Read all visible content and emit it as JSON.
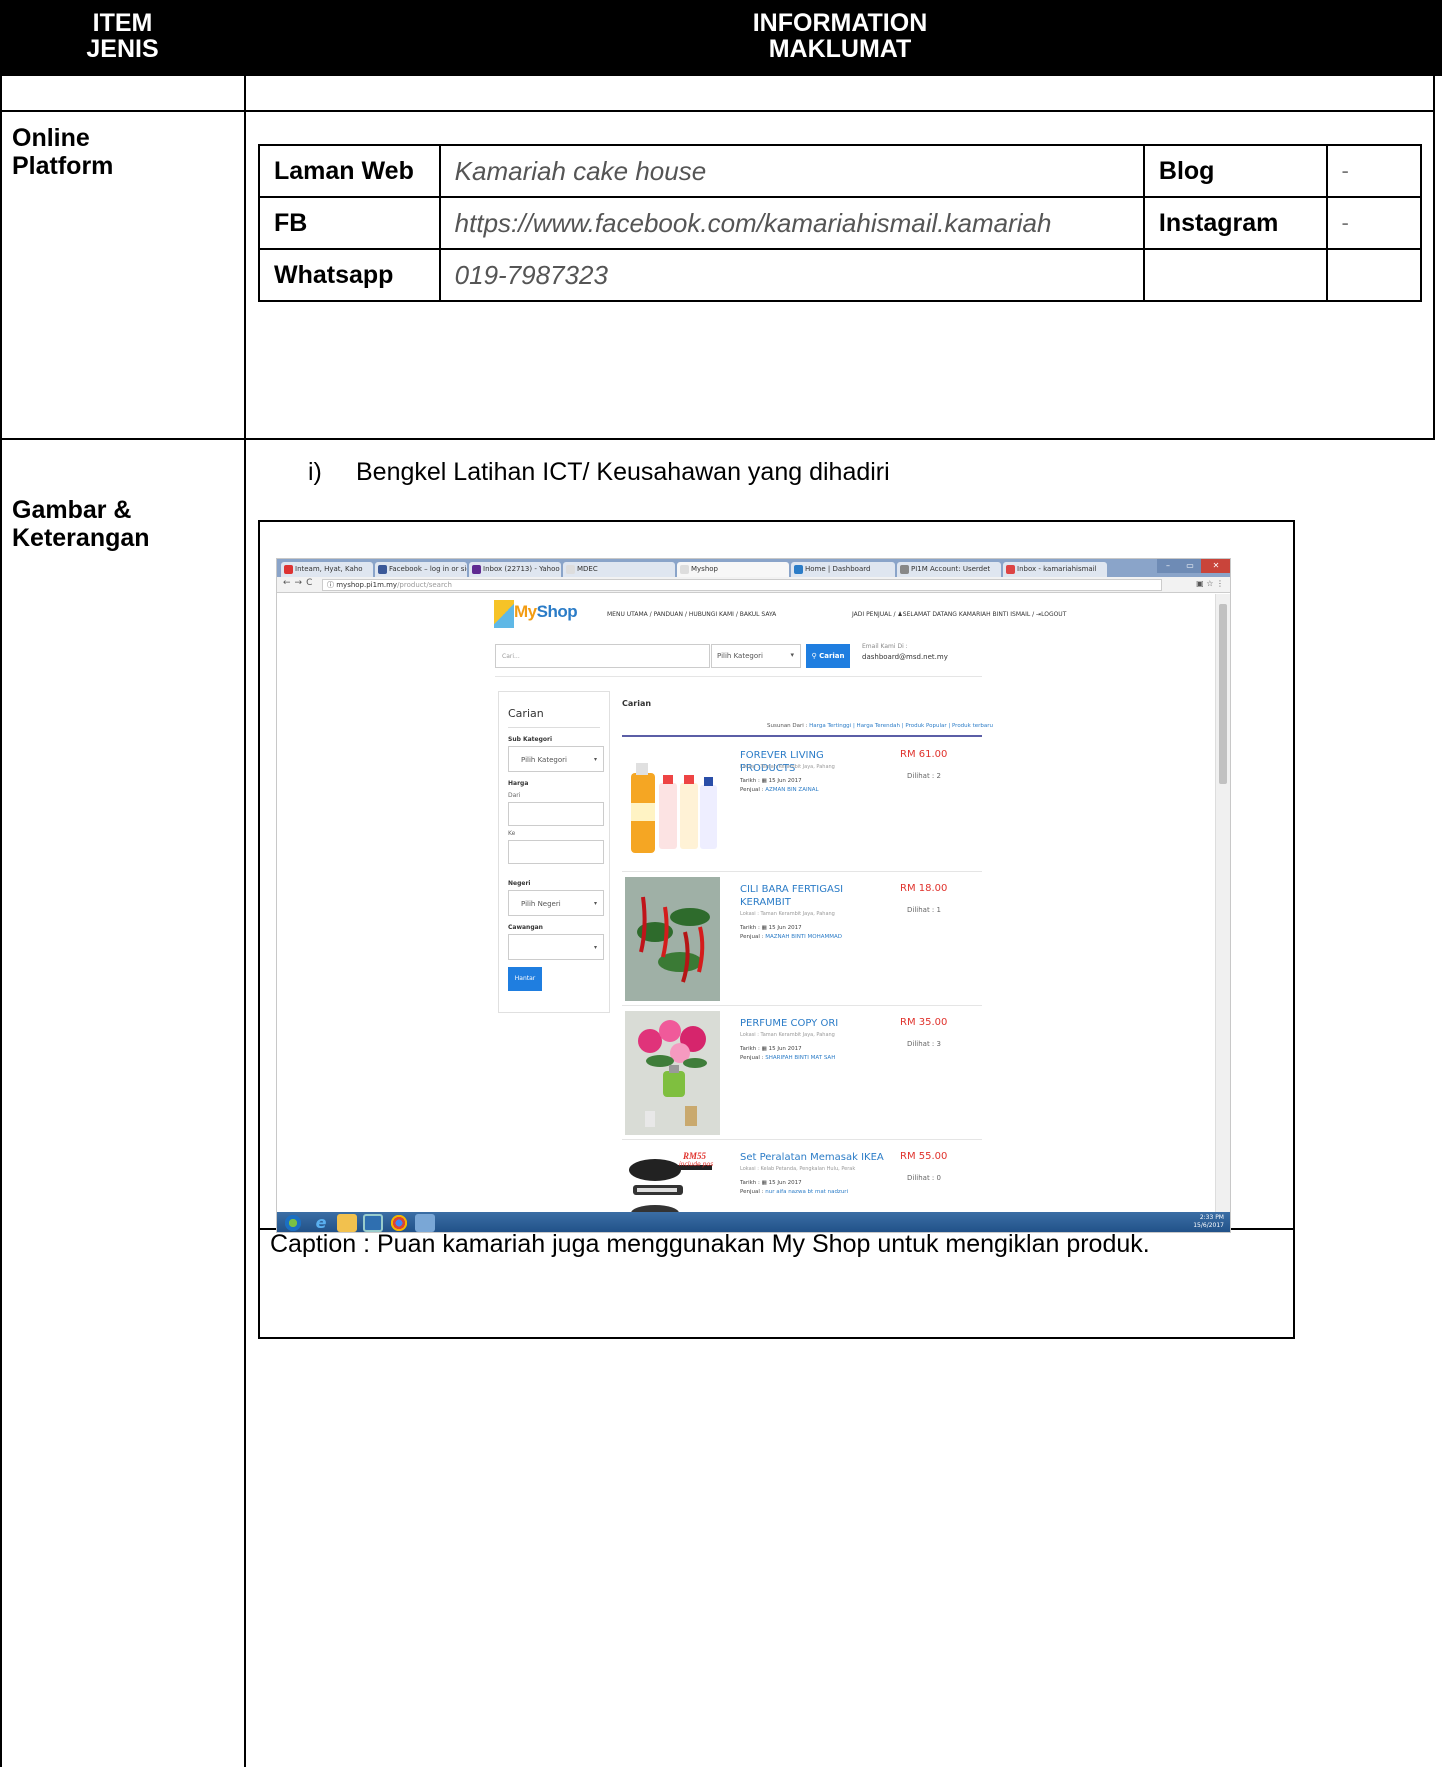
{
  "header": {
    "item_line1": "ITEM",
    "item_line2": "JENIS",
    "info_line1": "INFORMATION",
    "info_line2": "MAKLUMAT"
  },
  "online_platform": {
    "label_line1": "Online",
    "label_line2": "Platform",
    "rows": [
      {
        "key": "Laman Web",
        "value": "Kamariah cake house",
        "key2": "Blog",
        "value2": "-"
      },
      {
        "key": "FB",
        "value": "https://www.facebook.com/kamariahismail.kamariah",
        "key2": "Instagram",
        "value2": "-"
      },
      {
        "key": "Whatsapp",
        "value": "019-7987323",
        "key2": "",
        "value2": ""
      }
    ]
  },
  "gambar": {
    "label_line1": "Gambar &",
    "label_line2": "Keterangan",
    "item_number": "i)",
    "item_text": "Bengkel Latihan ICT/ Keusahawan yang dihadiri",
    "caption": "Caption : Puan kamariah juga menggunakan My Shop untuk mengiklan produk."
  },
  "screenshot": {
    "tabs": [
      "Inteam, Hyat, Kaho",
      "Facebook – log in or sig",
      "Inbox (22713) - Yahoo M",
      "MDEC",
      "Myshop",
      "Home | Dashboard",
      "PI1M Account: Userdet",
      "Inbox - kamariahismail"
    ],
    "url_host": "myshop.pi1m.my",
    "url_path": "/product/search",
    "logo_my": "My",
    "logo_shop": "Shop",
    "top_nav": "MENU UTAMA / PANDUAN / HUBUNGI KAMI / BAKUL SAYA",
    "user_nav": "JADI PENJUAL / ♟SELAMAT DATANG KAMARIAH BINTI ISMAIL / ⇥LOGOUT",
    "search_placeholder": "Cari...",
    "category_select": "Pilih Kategori",
    "search_button": "Carian",
    "email_label": "Email Kami Di :",
    "email": "dashboard@msd.net.my",
    "sidebar": {
      "title": "Carian",
      "sub_kategori": "Sub Kategori",
      "pilih_kategori": "Pilih Kategori",
      "harga": "Harga",
      "dari": "Dari",
      "ke": "Ke",
      "negeri": "Negeri",
      "pilih_negeri": "Pilih Negeri",
      "cawangan": "Cawangan",
      "hantar": "Hantar"
    },
    "results_title": "Carian",
    "sort_prefix": "Susunan Dari :",
    "sort_links": "Harga Tertinggi | Harga Terendah | Produk Popular | Produk terbaru",
    "products": [
      {
        "name": "FOREVER LIVING PRODUCTS",
        "price": "RM 61.00",
        "location": "Lokasi : Taman Kerambit Jaya, Pahang",
        "date": "Tarikh : ▦ 15 Jun 2017",
        "seller_prefix": "Penjual :",
        "seller": "AZMAN BIN ZAINAL",
        "views": "Dilihat : 2"
      },
      {
        "name": "CILI BARA FERTIGASI KERAMBIT",
        "price": "RM 18.00",
        "location": "Lokasi : Taman Kerambit Jaya, Pahang",
        "date": "Tarikh : ▦ 15 Jun 2017",
        "seller_prefix": "Penjual :",
        "seller": "MAZNAH BINTI MOHAMMAD",
        "views": "Dilihat : 1"
      },
      {
        "name": "PERFUME COPY ORI",
        "price": "RM 35.00",
        "location": "Lokasi : Taman Kerambit Jaya, Pahang",
        "date": "Tarikh : ▦ 15 Jun 2017",
        "seller_prefix": "Penjual :",
        "seller": "SHARIFAH BINTI MAT SAH",
        "views": "Dilihat : 3"
      },
      {
        "name": "Set Peralatan Memasak IKEA",
        "price": "RM 55.00",
        "location": "Lokasi : Kelab Petanda, Pengkalan Hulu, Perak",
        "date": "Tarikh : ▦ 15 Jun 2017",
        "seller_prefix": "Penjual :",
        "seller": "nur aifa nazwa bt mat nadzuri",
        "views": "Dilihat : 0"
      }
    ],
    "image_badge": "RM55",
    "image_badge_sub": "include pos",
    "clock_time": "2:33 PM",
    "clock_date": "15/6/2017"
  }
}
